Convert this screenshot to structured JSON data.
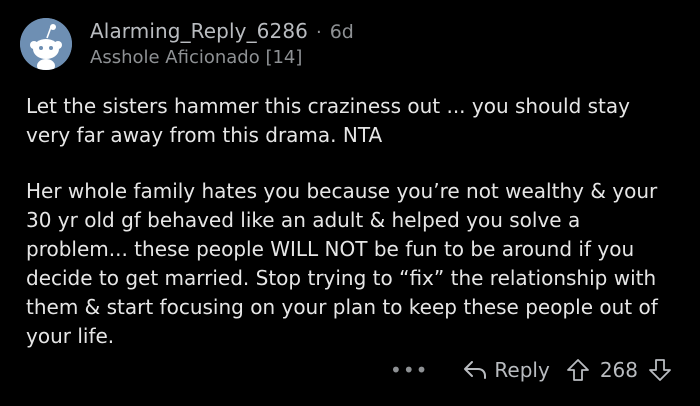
{
  "comment": {
    "username": "Alarming_Reply_6286",
    "separator": "·",
    "age": "6d",
    "flair": "Asshole Aficionado [14]",
    "paragraphs": [
      "Let the sisters hammer this craziness out ... you should stay very far away from this drama. NTA",
      "Her whole family hates you because you’re not wealthy & your 30 yr old gf behaved like an adult & helped you solve a problem... these people WILL NOT be fun to be around if you decide to get married. Stop trying to “fix” the relationship with them & start focusing on your plan to keep these people out of your life."
    ],
    "actions": {
      "more": "•••",
      "reply_label": "Reply",
      "score": "268"
    },
    "icons": {
      "avatar": "reddit-snoo-avatar",
      "reply": "reply-arrow-icon",
      "upvote": "upvote-arrow-icon",
      "downvote": "downvote-arrow-icon"
    },
    "colors": {
      "background": "#000000",
      "text": "#e6e6e6",
      "meta": "#8e9194",
      "avatar_bg": "#6e8fb3"
    }
  }
}
